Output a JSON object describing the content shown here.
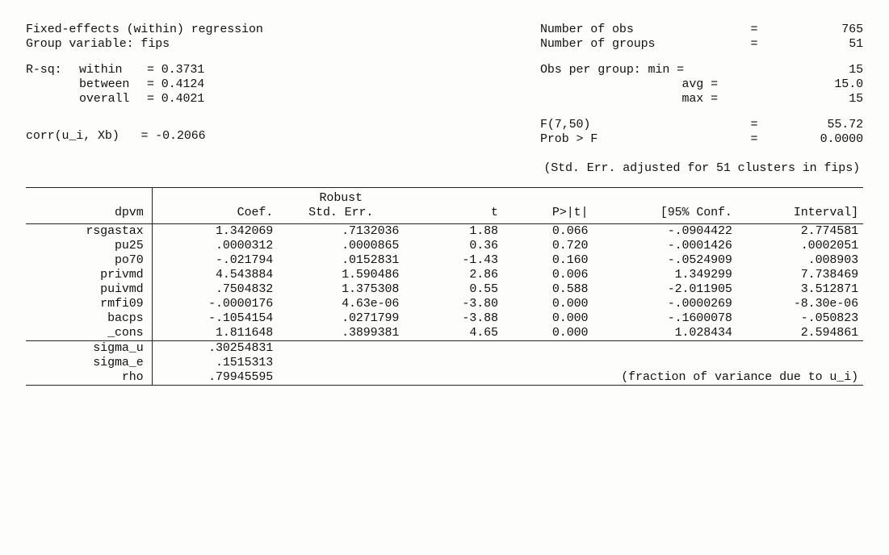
{
  "header": {
    "title": "Fixed-effects (within) regression",
    "group_var_label": "Group variable: fips",
    "rsq_label": "R-sq:",
    "rsq": {
      "within": "= 0.3731",
      "between": "= 0.4124",
      "overall": "= 0.4021"
    },
    "corr_label": "corr(u_i, Xb)",
    "corr_value": "=  -0.2066",
    "right": {
      "nobs_label": "Number of obs",
      "nobs_value": "765",
      "ngrp_label": "Number of groups",
      "ngrp_value": "51",
      "opg_label": "Obs per group:",
      "opg_min_k": "min =",
      "opg_min_v": "15",
      "opg_avg_k": "avg =",
      "opg_avg_v": "15.0",
      "opg_max_k": "max =",
      "opg_max_v": "15",
      "f_label": "F(7,50)",
      "f_value": "55.72",
      "pf_label": "Prob > F",
      "pf_value": "0.0000"
    },
    "adjust_note": "(Std. Err. adjusted for 51 clusters in fips)"
  },
  "table": {
    "depvar": "dpvm",
    "hdr_coef": "Coef.",
    "hdr_se1": "Robust",
    "hdr_se2": "Std. Err.",
    "hdr_t": "t",
    "hdr_p": "P>|t|",
    "hdr_ci1": "[95% Conf.",
    "hdr_ci2": "Interval]",
    "rows": [
      {
        "var": "rsgastax",
        "coef": "1.342069",
        "se": ".7132036",
        "t": "1.88",
        "p": "0.066",
        "lo": "-.0904422",
        "hi": "2.774581"
      },
      {
        "var": "pu25",
        "coef": ".0000312",
        "se": ".0000865",
        "t": "0.36",
        "p": "0.720",
        "lo": "-.0001426",
        "hi": ".0002051"
      },
      {
        "var": "po70",
        "coef": "-.021794",
        "se": ".0152831",
        "t": "-1.43",
        "p": "0.160",
        "lo": "-.0524909",
        "hi": ".008903"
      },
      {
        "var": "privmd",
        "coef": "4.543884",
        "se": "1.590486",
        "t": "2.86",
        "p": "0.006",
        "lo": "1.349299",
        "hi": "7.738469"
      },
      {
        "var": "puivmd",
        "coef": ".7504832",
        "se": "1.375308",
        "t": "0.55",
        "p": "0.588",
        "lo": "-2.011905",
        "hi": "3.512871"
      },
      {
        "var": "rmfi09",
        "coef": "-.0000176",
        "se": "4.63e-06",
        "t": "-3.80",
        "p": "0.000",
        "lo": "-.0000269",
        "hi": "-8.30e-06"
      },
      {
        "var": "bacps",
        "coef": "-.1054154",
        "se": ".0271799",
        "t": "-3.88",
        "p": "0.000",
        "lo": "-.1600078",
        "hi": "-.050823"
      },
      {
        "var": "_cons",
        "coef": "1.811648",
        "se": ".3899381",
        "t": "4.65",
        "p": "0.000",
        "lo": "1.028434",
        "hi": "2.594861"
      }
    ],
    "foot": {
      "sigma_u_k": "sigma_u",
      "sigma_u_v": ".30254831",
      "sigma_e_k": "sigma_e",
      "sigma_e_v": ".1515313",
      "rho_k": "rho",
      "rho_v": ".79945595",
      "rho_note": "(fraction of variance due to u_i)"
    }
  }
}
